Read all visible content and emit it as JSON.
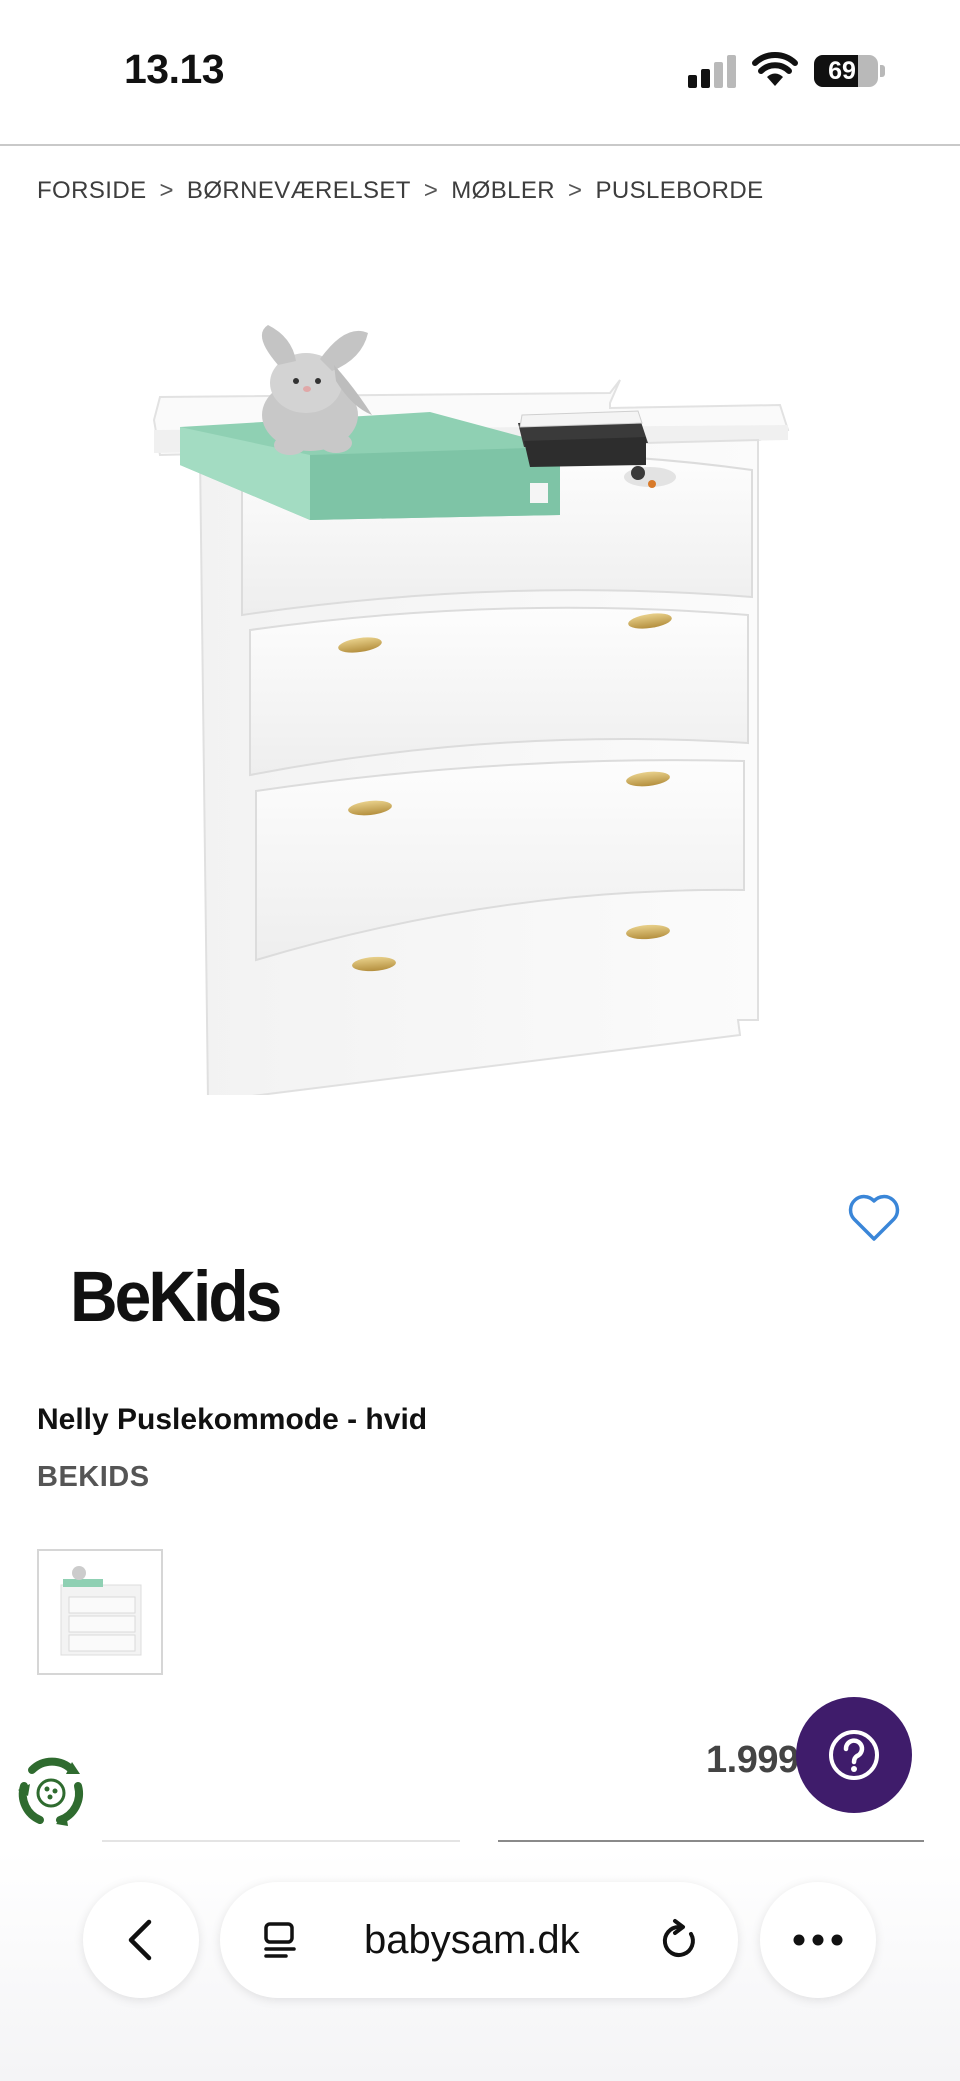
{
  "status_bar": {
    "time": "13.13",
    "battery_level": "69",
    "icons": [
      "cellular-signal-icon",
      "wifi-icon",
      "battery-icon"
    ]
  },
  "breadcrumb": {
    "items": [
      "FORSIDE",
      "BØRNEVÆRELSET",
      "MØBLER",
      "PUSLEBORDE"
    ],
    "separator": ">"
  },
  "product": {
    "logo_text": "BeKids",
    "title": "Nelly Puslekommode - hvid",
    "brand": "BEKIDS",
    "price": "1.999 kr.",
    "favorite_icon": "heart-outline-icon",
    "image_color": "#ffffff",
    "changing_pad_color": "#8fd0b3"
  },
  "help": {
    "icon": "question-mark-icon",
    "color": "#3f1c6b"
  },
  "eco_badge": {
    "icon": "recycle-leaf-icon",
    "color": "#2f6b2f"
  },
  "browser": {
    "url": "babysam.dk",
    "icons": [
      "back-chevron-icon",
      "reader-mode-icon",
      "reload-icon",
      "more-dots-icon"
    ]
  }
}
